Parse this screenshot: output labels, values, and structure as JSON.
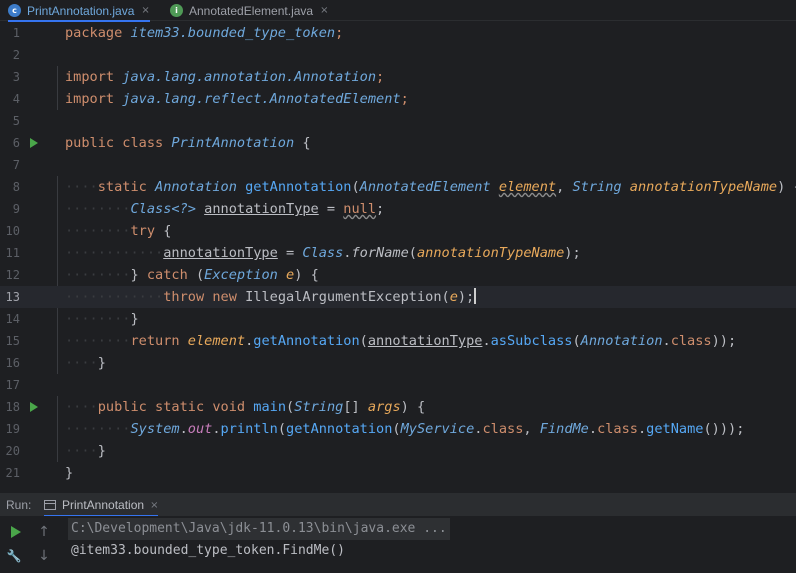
{
  "tabs": [
    {
      "label": "PrintAnnotation.java",
      "icon": "class-icon",
      "icon_letter": "c",
      "icon_color": "#3d7cc9",
      "active": true
    },
    {
      "label": "AnnotatedElement.java",
      "icon": "interface-icon",
      "icon_letter": "i",
      "icon_color": "#4f9a56",
      "active": false
    }
  ],
  "tab_close_glyph": "×",
  "editor": {
    "current_line": 13,
    "line_numbers": [
      "1",
      "2",
      "3",
      "4",
      "5",
      "6",
      "7",
      "8",
      "9",
      "10",
      "11",
      "12",
      "13",
      "14",
      "15",
      "16",
      "17",
      "18",
      "19",
      "20",
      "21"
    ],
    "code": {
      "l1_kw": "package",
      "l1_pkg": "item33.bounded_type_token",
      "l1_end": ";",
      "l3_kw": "import",
      "l3_pkg": "java.lang.annotation.Annotation",
      "l3_end": ";",
      "l4_kw": "import",
      "l4_pkg": "java.lang.reflect.AnnotatedElement",
      "l4_end": ";",
      "l6_kw1": "public",
      "l6_kw2": "class",
      "l6_name": "PrintAnnotation",
      "l6_end": "{",
      "l8_kw": "static",
      "l8_type": "Annotation",
      "l8_fn": "getAnnotation",
      "l8_p1type": "AnnotatedElement",
      "l8_p1": "element",
      "l8_p2type": "String",
      "l8_p2": "annotationTypeName",
      "l9_type": "Class<?>",
      "l9_var": "annotationType",
      "l9_val": "null",
      "l10_kw": "try",
      "l11_var": "annotationType",
      "l11_cls": "Class",
      "l11_fn": "forName",
      "l11_arg": "annotationTypeName",
      "l12_kw": "catch",
      "l12_type": "Exception",
      "l12_var": "e",
      "l13_kw1": "throw",
      "l13_kw2": "new",
      "l13_cls": "IllegalArgumentException",
      "l13_arg": "e",
      "l15_kw": "return",
      "l15_var": "element",
      "l15_fn": "getAnnotation",
      "l15_arg": "annotationType",
      "l15_fn2": "asSubclass",
      "l15_cls": "Annotation",
      "l15_kw2": "class",
      "l18_kw1": "public",
      "l18_kw2": "static",
      "l18_kw3": "void",
      "l18_fn": "main",
      "l18_type": "String",
      "l18_param": "args",
      "l19_cls": "System",
      "l19_fld": "out",
      "l19_fn": "println",
      "l19_fn2": "getAnnotation",
      "l19_c1": "MyService",
      "l19_kw1": "class",
      "l19_c2": "FindMe",
      "l19_kw2": "class",
      "l19_fn3": "getName"
    }
  },
  "run_panel": {
    "label": "Run:",
    "tab_label": "PrintAnnotation",
    "command": "C:\\Development\\Java\\jdk-11.0.13\\bin\\java.exe ...",
    "output": "@item33.bounded_type_token.FindMe()",
    "buttons": {
      "up": "↑",
      "down": "↓",
      "wrench": "🔧"
    }
  }
}
